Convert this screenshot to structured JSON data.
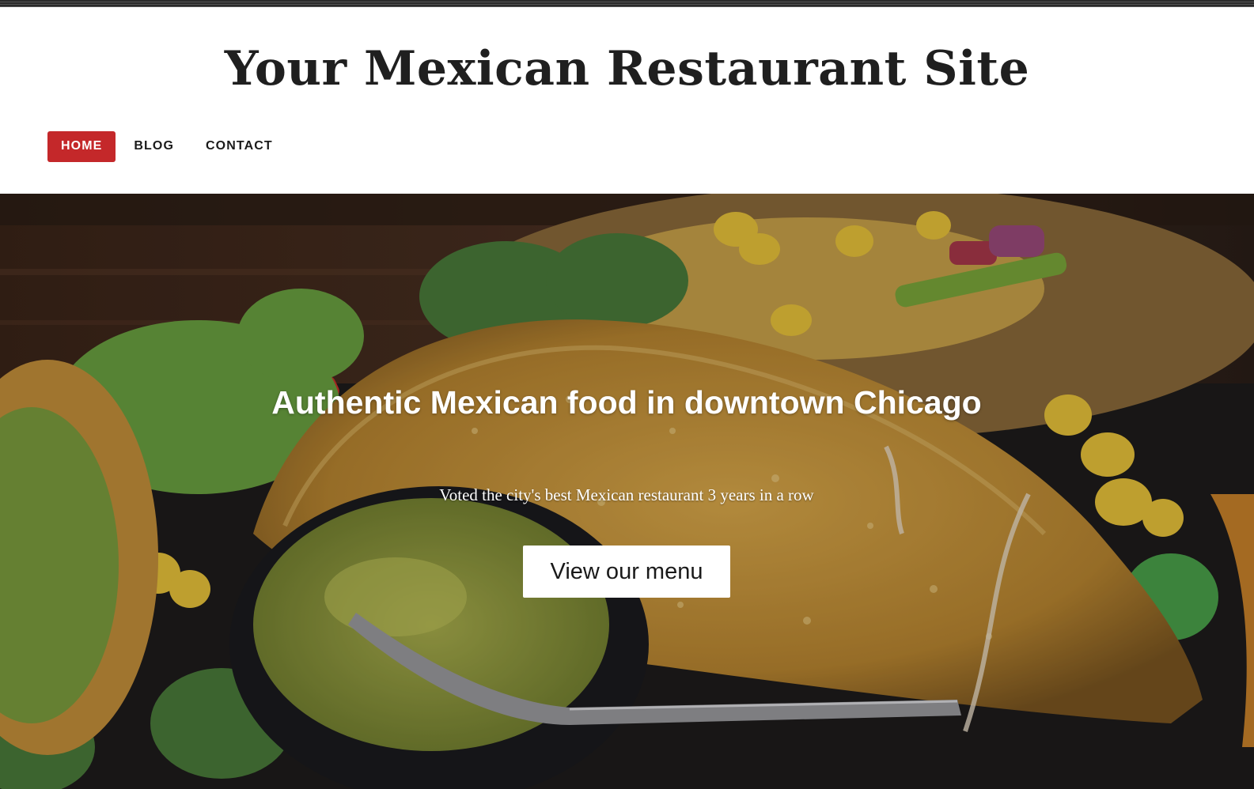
{
  "site": {
    "title": "Your Mexican Restaurant Site"
  },
  "nav": {
    "items": [
      {
        "label": "HOME",
        "active": true
      },
      {
        "label": "BLOG",
        "active": false
      },
      {
        "label": "CONTACT",
        "active": false
      }
    ]
  },
  "hero": {
    "heading": "Authentic Mexican food in downtown Chicago",
    "tagline": "Voted the city's best Mexican restaurant 3 years in a row",
    "button_label": "View our menu",
    "image_subject": "tacos-with-guacamole-photo"
  },
  "colors": {
    "accent": "#c4282a",
    "title_text": "#1f1f1f",
    "hero_text": "#ffffff"
  }
}
